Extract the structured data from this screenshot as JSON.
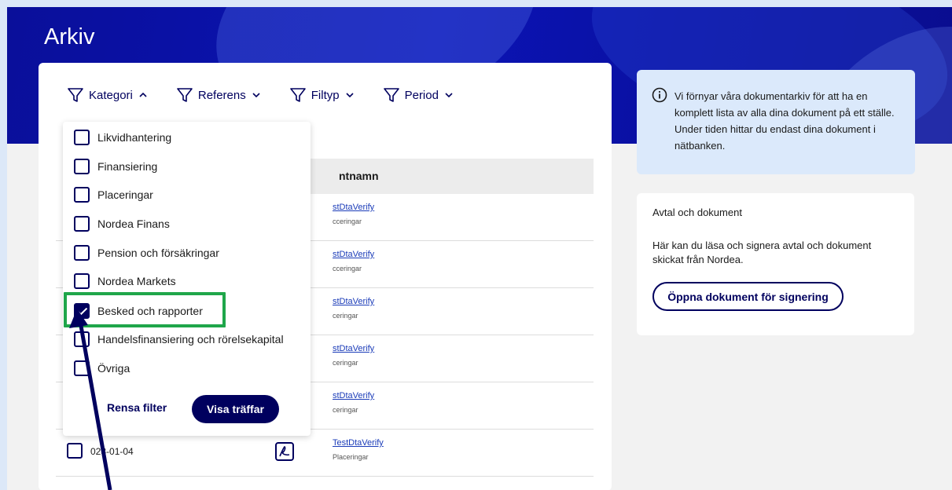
{
  "page": {
    "title": "Arkiv"
  },
  "filters": [
    {
      "label": "Kategori",
      "expanded": true
    },
    {
      "label": "Referens",
      "expanded": false
    },
    {
      "label": "Filtyp",
      "expanded": false
    },
    {
      "label": "Period",
      "expanded": false
    }
  ],
  "table": {
    "header": "ntnamn",
    "rows": [
      {
        "link": "stDtaVerify",
        "category": "cceringar"
      },
      {
        "link": "stDtaVerify",
        "category": "cceringar"
      },
      {
        "link": "stDtaVerify",
        "category": "ceringar"
      },
      {
        "link": "stDtaVerify",
        "category": "ceringar"
      },
      {
        "link": "stDtaVerify",
        "category": "ceringar"
      },
      {
        "date": "023-01-04",
        "link": "TestDtaVerify",
        "category": "Placeringar"
      }
    ]
  },
  "category_dropdown": {
    "options": [
      {
        "label": "Likvidhantering",
        "checked": false
      },
      {
        "label": "Finansiering",
        "checked": false
      },
      {
        "label": "Placeringar",
        "checked": false
      },
      {
        "label": "Nordea Finans",
        "checked": false
      },
      {
        "label": "Pension och försäkringar",
        "checked": false
      },
      {
        "label": "Nordea Markets",
        "checked": false
      },
      {
        "label": "Besked och rapporter",
        "checked": true
      },
      {
        "label": "Handelsfinansiering och rörelsekapital",
        "checked": false
      },
      {
        "label": "Övriga",
        "checked": false
      }
    ],
    "clear_label": "Rensa filter",
    "show_label": "Visa träffar"
  },
  "info": {
    "text": "Vi förnyar våra dokumentarkiv för att ha en komplett lista av alla dina dokument på ett ställe. Under tiden hittar du endast dina dokument i nätbanken."
  },
  "agreements": {
    "title": "Avtal och dokument",
    "text": "Här kan du läsa och signera avtal och dokument skickat från Nordea.",
    "button_label": "Öppna dokument för signering"
  },
  "colors": {
    "brand_dark": "#00005e",
    "hero_blue": "#0b14b5",
    "highlight_green": "#1fa64a",
    "link_blue": "#1a3bb8",
    "info_bg": "#dbe9fb"
  }
}
